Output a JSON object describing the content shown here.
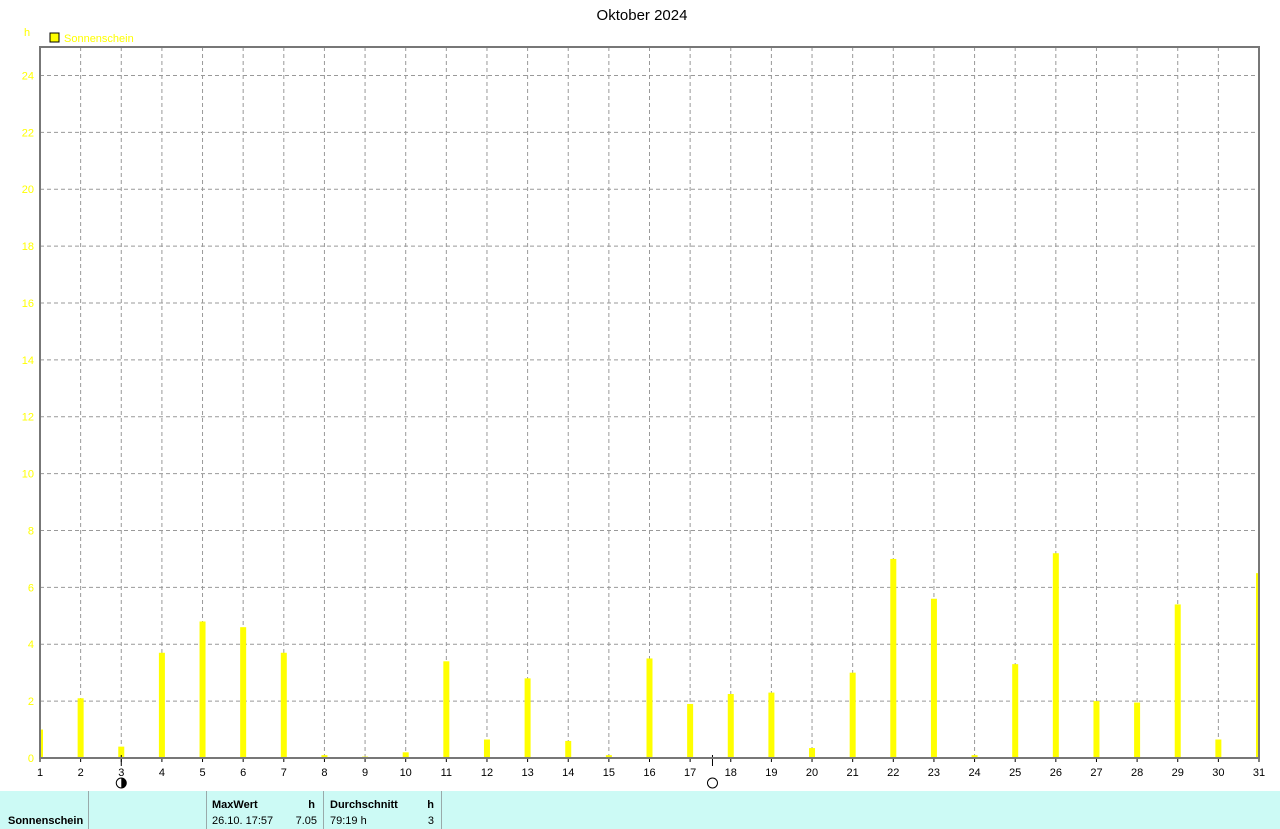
{
  "chart_data": {
    "type": "bar",
    "title": "Oktober 2024",
    "ylabel": "h",
    "ylim": [
      0,
      25
    ],
    "yticks": [
      0,
      2,
      4,
      6,
      8,
      10,
      12,
      14,
      16,
      18,
      20,
      22,
      24
    ],
    "grid": true,
    "legend": "top-left",
    "series": [
      {
        "name": "Sonnenschein",
        "color": "#ffff00",
        "x": [
          1,
          2,
          3,
          4,
          5,
          6,
          7,
          8,
          9,
          10,
          11,
          12,
          13,
          14,
          15,
          16,
          17,
          18,
          19,
          20,
          21,
          22,
          23,
          24,
          25,
          26,
          27,
          28,
          29,
          30,
          31
        ],
        "values": [
          1.0,
          2.1,
          0.4,
          3.7,
          4.8,
          4.6,
          3.7,
          0.1,
          0.05,
          0.2,
          3.4,
          0.65,
          2.8,
          0.6,
          0.1,
          3.5,
          1.9,
          2.25,
          2.3,
          0.35,
          3.0,
          7.0,
          5.6,
          0.1,
          3.3,
          7.2,
          2.0,
          1.95,
          5.4,
          0.65,
          6.5
        ]
      }
    ],
    "markers": [
      {
        "x": 3,
        "icon": "half-moon-icon"
      },
      {
        "x": 17.55,
        "icon": "full-moon-icon"
      }
    ]
  },
  "summary": {
    "series_label": "Sonnenschein",
    "max_header": "MaxWert",
    "max_unit": "h",
    "max_when": "26.10.  17:57",
    "max_value": "7.05",
    "avg_header": "Durchschnitt",
    "avg_unit": "h",
    "avg_total": "79:19 h",
    "avg_value": "3"
  }
}
